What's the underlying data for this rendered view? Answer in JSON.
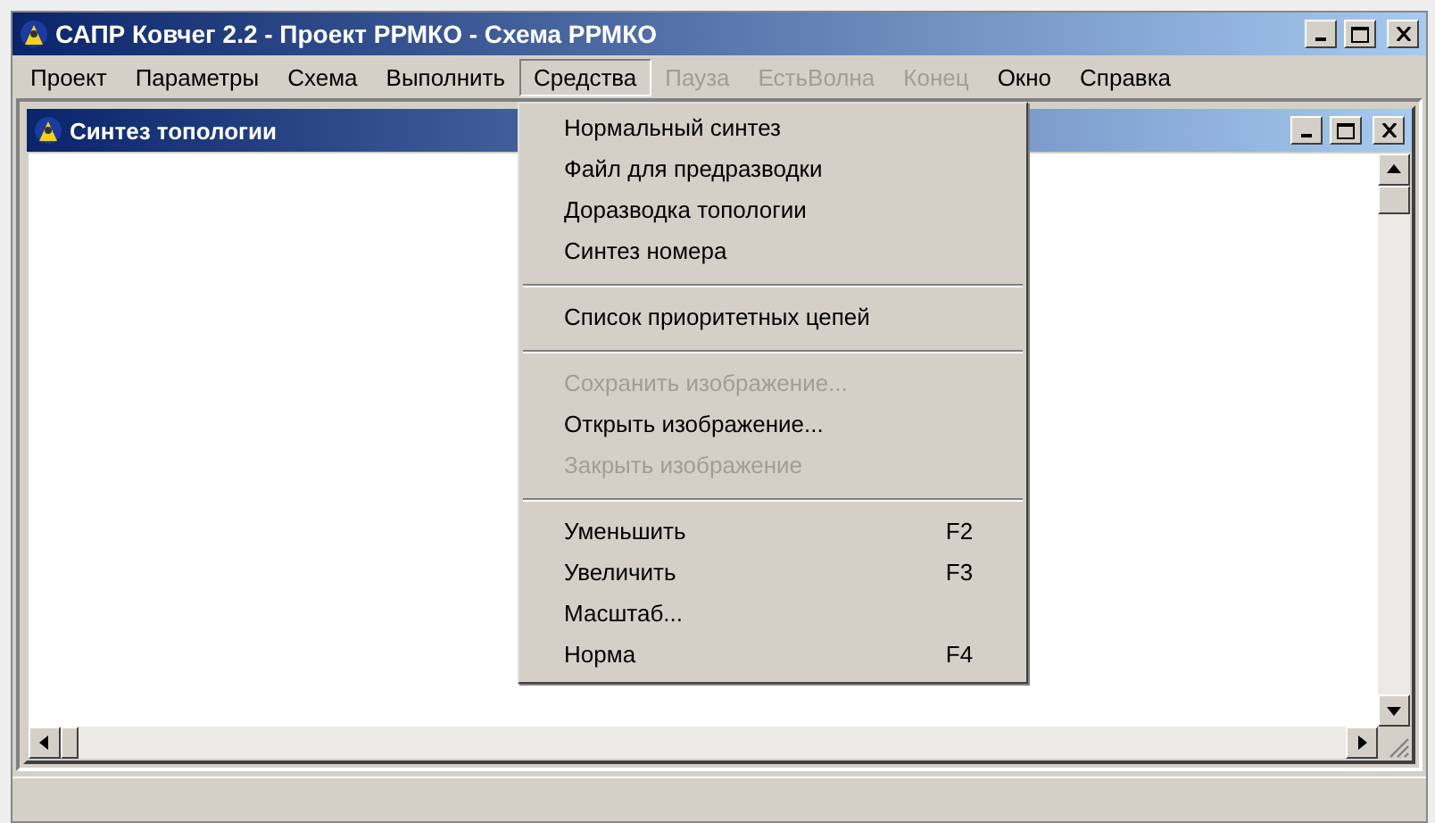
{
  "window": {
    "title": "САПР Ковчег 2.2 - Проект РРМКО - Схема РРМКО"
  },
  "menus": [
    {
      "label": "Проект",
      "selected": false,
      "disabled": false
    },
    {
      "label": "Параметры",
      "selected": false,
      "disabled": false
    },
    {
      "label": "Схема",
      "selected": false,
      "disabled": false
    },
    {
      "label": "Выполнить",
      "selected": false,
      "disabled": false
    },
    {
      "label": "Средства",
      "selected": true,
      "disabled": false,
      "items": [
        {
          "kind": "item",
          "label": "Нормальный синтез",
          "disabled": false
        },
        {
          "kind": "item",
          "label": "Файл для предразводки",
          "disabled": false
        },
        {
          "kind": "item",
          "label": "Доразводка топологии",
          "disabled": false
        },
        {
          "kind": "item",
          "label": "Синтез номера",
          "disabled": false
        },
        {
          "kind": "separator"
        },
        {
          "kind": "item",
          "label": "Список приоритетных цепей",
          "disabled": false
        },
        {
          "kind": "separator"
        },
        {
          "kind": "item",
          "label": "Сохранить изображение...",
          "disabled": true
        },
        {
          "kind": "item",
          "label": "Открыть изображение...",
          "disabled": false
        },
        {
          "kind": "item",
          "label": "Закрыть изображение",
          "disabled": true
        },
        {
          "kind": "separator"
        },
        {
          "kind": "item",
          "label": "Уменьшить",
          "shortcut": "F2",
          "disabled": false
        },
        {
          "kind": "item",
          "label": "Увеличить",
          "shortcut": "F3",
          "disabled": false
        },
        {
          "kind": "item",
          "label": "Масштаб...",
          "disabled": false
        },
        {
          "kind": "item",
          "label": "Норма",
          "shortcut": "F4",
          "disabled": false
        }
      ]
    },
    {
      "label": "Пауза",
      "selected": false,
      "disabled": true
    },
    {
      "label": "ЕстьВолна",
      "selected": false,
      "disabled": true
    },
    {
      "label": "Конец",
      "selected": false,
      "disabled": true
    },
    {
      "label": "Окно",
      "selected": false,
      "disabled": false
    },
    {
      "label": "Справка",
      "selected": false,
      "disabled": false
    }
  ],
  "child_window": {
    "title": "Синтез топологии"
  }
}
